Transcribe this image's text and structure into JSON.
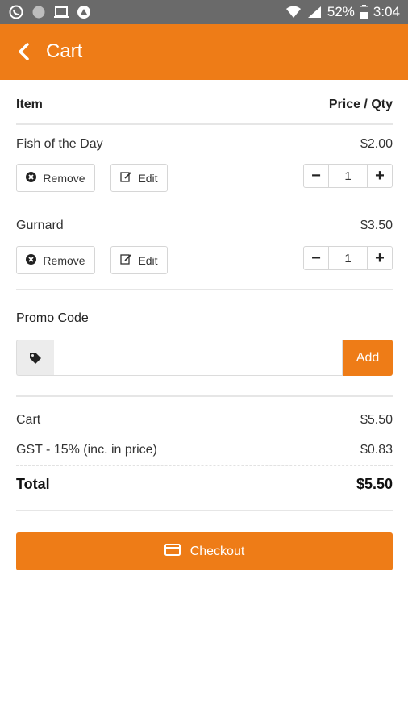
{
  "status_bar": {
    "battery": "52%",
    "time": "3:04",
    "icons": [
      "whatsapp-icon",
      "circle-icon",
      "laptop-icon",
      "app-icon",
      "wifi-icon",
      "signal-icon",
      "battery-icon"
    ]
  },
  "app_bar": {
    "title": "Cart",
    "back_icon": "chevron-left-icon",
    "color": "#ee7c17"
  },
  "table": {
    "item_header": "Item",
    "price_header": "Price / Qty"
  },
  "items": [
    {
      "name": "Fish of the Day",
      "price": "$2.00",
      "qty": "1",
      "remove_label": "Remove",
      "edit_label": "Edit"
    },
    {
      "name": "Gurnard",
      "price": "$3.50",
      "qty": "1",
      "remove_label": "Remove",
      "edit_label": "Edit"
    }
  ],
  "stepper": {
    "minus": "−",
    "plus": "+"
  },
  "promo": {
    "label": "Promo Code",
    "placeholder": "",
    "value": "",
    "add_label": "Add",
    "tag_icon": "tag-icon"
  },
  "summary": {
    "cart_label": "Cart",
    "cart_value": "$5.50",
    "gst_label": "GST - 15% (inc. in price)",
    "gst_value": "$0.83",
    "total_label": "Total",
    "total_value": "$5.50"
  },
  "checkout": {
    "label": "Checkout",
    "icon": "credit-card-icon"
  }
}
